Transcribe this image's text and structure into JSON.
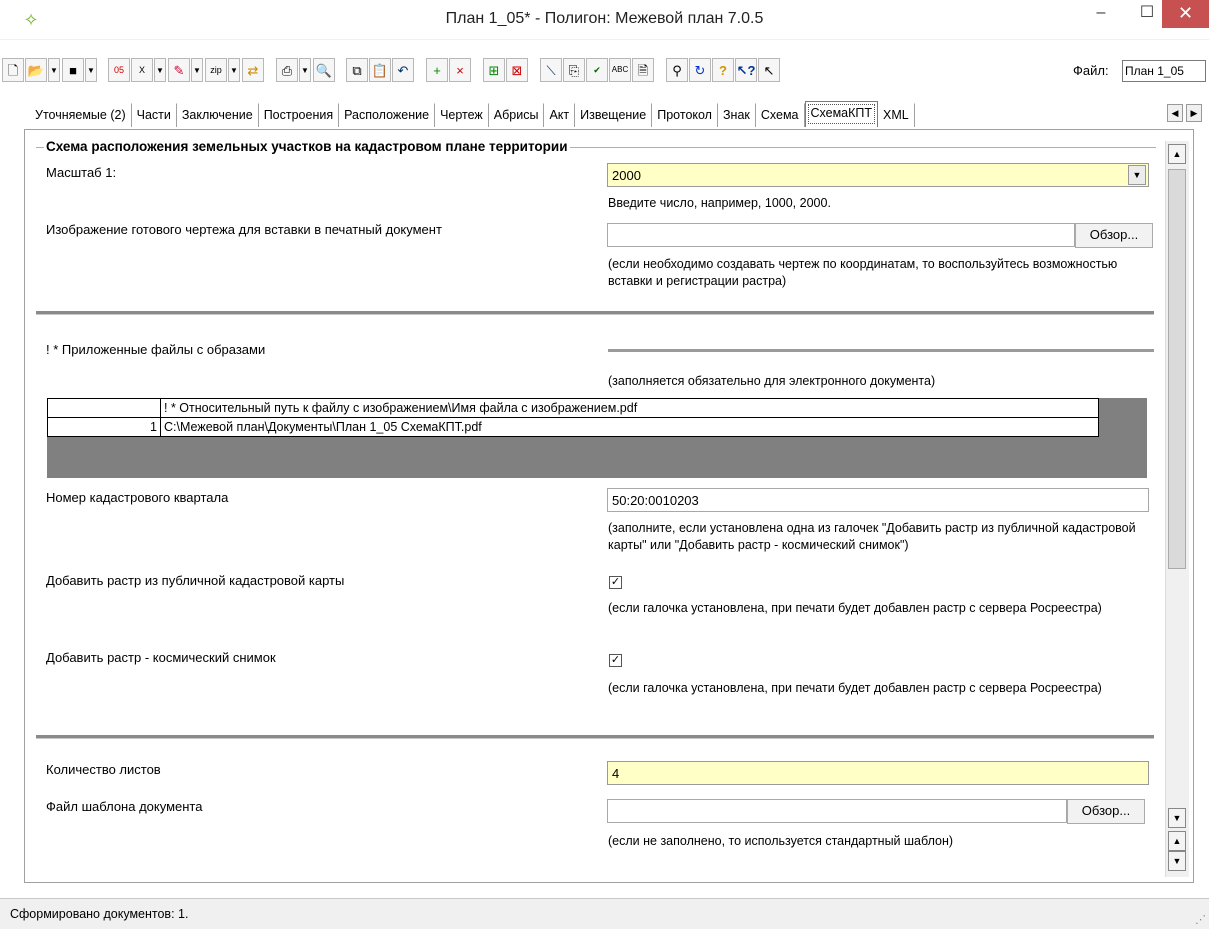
{
  "window": {
    "title": "План 1_05* - Полигон: Межевой план 7.0.5",
    "icon": "app-logo-icon",
    "minimize": "–",
    "maximize": "☐",
    "close": "✕"
  },
  "toolbar": {
    "buttons": [
      "new-icon",
      "open-icon",
      "save-icon",
      "xml-05-icon",
      "xml-icon",
      "edit-icon",
      "zip-icon",
      "swap-icon",
      "print-icon",
      "preview-icon",
      "copy-icon",
      "paste-icon",
      "undo-icon",
      "add-icon",
      "delete-icon",
      "add-part-icon",
      "remove-part-icon",
      "line-icon",
      "copy-doc-icon",
      "xml-check-icon",
      "spell-icon",
      "document-icon",
      "search-icon",
      "refresh-icon",
      "help-icon",
      "context-help-icon",
      "pointer-icon"
    ],
    "file_label": "Файл:",
    "file_value": "План 1_05"
  },
  "tabs": [
    {
      "label": "Уточняемые (2)",
      "active": false
    },
    {
      "label": "Части",
      "active": false
    },
    {
      "label": "Заключение",
      "active": false
    },
    {
      "label": "Построения",
      "active": false
    },
    {
      "label": "Расположение",
      "active": false
    },
    {
      "label": "Чертеж",
      "active": false
    },
    {
      "label": "Абрисы",
      "active": false
    },
    {
      "label": "Акт",
      "active": false
    },
    {
      "label": "Извещение",
      "active": false
    },
    {
      "label": "Протокол",
      "active": false
    },
    {
      "label": "Знак",
      "active": false
    },
    {
      "label": "Схема",
      "active": false
    },
    {
      "label": "СхемаКПТ",
      "active": true
    },
    {
      "label": "XML",
      "active": false
    }
  ],
  "form": {
    "group_title": "Схема расположения земельных участков на кадастровом плане территории",
    "scale_label": "Масштаб 1:",
    "scale_value": "2000",
    "scale_hint": "Введите число, например, 1000, 2000.",
    "image_label": "Изображение готового чертежа для вставки в печатный документ",
    "image_value": "",
    "browse_label": "Обзор...",
    "image_hint": "(если необходимо создавать чертеж по координатам, то воспользуйтесь возможностью вставки и регистрации растра)",
    "attached_label": "! * Приложенные файлы с образами",
    "attached_hint": "(заполняется обязательно для электронного документа)",
    "grid_header": "! * Относительный путь к файлу с изображением\\Имя файла с изображением.pdf",
    "grid_rows": [
      {
        "num": "1",
        "path": "C:\\Межевой план\\Документы\\План 1_05 СхемаКПТ.pdf"
      }
    ],
    "cadastral_label": "Номер кадастрового квартала",
    "cadastral_value": "50:20:0010203",
    "cadastral_hint": "(заполните, если установлена одна из галочек \"Добавить растр из публичной кадастровой карты\" или \"Добавить растр - космический снимок\")",
    "pkk_label": "Добавить растр из публичной кадастровой карты",
    "pkk_checked": true,
    "pkk_hint": "(если галочка установлена, при печати будет добавлен растр с сервера Росреестра)",
    "sat_label": "Добавить растр - космический снимок",
    "sat_checked": true,
    "sat_hint": "(если галочка установлена, при печати будет добавлен растр с сервера Росреестра)",
    "sheets_label": "Количество листов",
    "sheets_value": "4",
    "template_label": "Файл шаблона документа",
    "template_value": "",
    "template_browse": "Обзор...",
    "template_hint": "(если не заполнено, то используется стандартный шаблон)",
    "check_mark": "✓"
  },
  "status": {
    "text": "Сформировано документов: 1."
  },
  "colors": {
    "required_field_bg": "#ffffc6",
    "close_button_bg": "#c75050",
    "grid_bg": "#808080"
  }
}
